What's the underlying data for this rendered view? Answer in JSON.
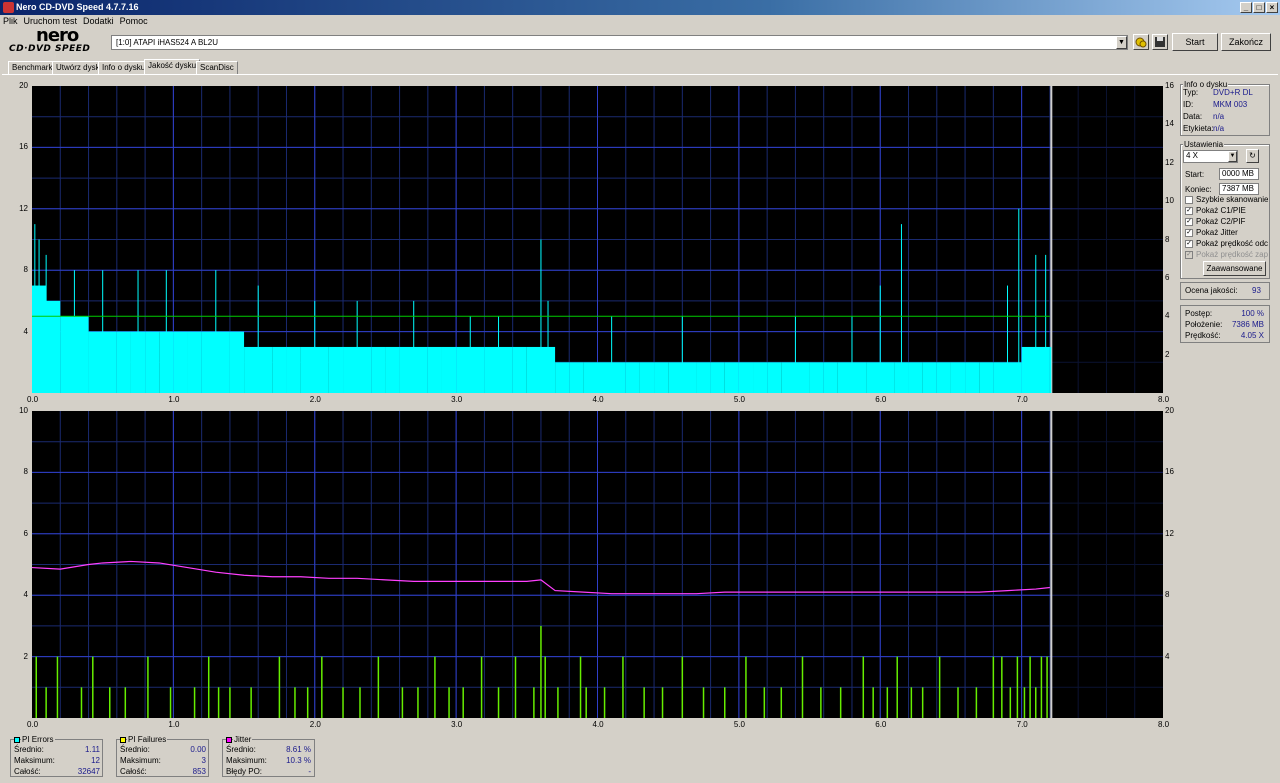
{
  "window": {
    "title": "Nero CD-DVD Speed 4.7.7.16",
    "minimize": "_",
    "maximize": "□",
    "close": "×"
  },
  "menu": [
    "Plik",
    "Uruchom test",
    "Dodatki",
    "Pomoc"
  ],
  "logo": {
    "main": "nero",
    "sub": "CD·DVD SPEED"
  },
  "toolbar": {
    "drive": "[1:0]   ATAPI iHAS524   A BL2U",
    "start": "Start",
    "close": "Zakończ"
  },
  "tabs": [
    "Benchmark",
    "Utwórz dysk",
    "Info o dysku",
    "Jakość dysku",
    "ScanDisc"
  ],
  "active_tab": 3,
  "disc_info": {
    "title": "Info o dysku",
    "rows": [
      {
        "label": "Typ:",
        "value": "DVD+R DL"
      },
      {
        "label": "ID:",
        "value": "MKM 003"
      },
      {
        "label": "Data:",
        "value": "n/a"
      },
      {
        "label": "Etykieta:",
        "value": "n/a"
      }
    ]
  },
  "settings": {
    "title": "Ustawienia",
    "speed": "4 X",
    "start_label": "Start:",
    "start_value": "0000 MB",
    "end_label": "Koniec:",
    "end_value": "7387 MB",
    "checks": [
      {
        "label": "Szybkie skanowanie",
        "checked": false,
        "enabled": true
      },
      {
        "label": "Pokaż C1/PIE",
        "checked": true,
        "enabled": true
      },
      {
        "label": "Pokaż C2/PIF",
        "checked": true,
        "enabled": true
      },
      {
        "label": "Pokaż Jitter",
        "checked": true,
        "enabled": true
      },
      {
        "label": "Pokaż prędkość odczytu",
        "checked": true,
        "enabled": true
      },
      {
        "label": "Pokaż prędkość zapisu",
        "checked": true,
        "enabled": false
      }
    ],
    "advanced": "Zaawansowane"
  },
  "quality": {
    "label": "Ocena jakości:",
    "value": "93"
  },
  "progress": {
    "rows": [
      {
        "label": "Postęp:",
        "value": "100 %"
      },
      {
        "label": "Położenie:",
        "value": "7386 MB"
      },
      {
        "label": "Prędkość:",
        "value": "4.05 X"
      }
    ]
  },
  "stats": {
    "pi_errors": {
      "title": "PI Errors",
      "color": "#00ffff",
      "rows": [
        {
          "label": "Średnio:",
          "value": "1.11"
        },
        {
          "label": "Maksimum:",
          "value": "12"
        },
        {
          "label": "Całość:",
          "value": "32647"
        }
      ]
    },
    "pi_failures": {
      "title": "PI Failures",
      "color": "#ffff00",
      "rows": [
        {
          "label": "Średnio:",
          "value": "0.00"
        },
        {
          "label": "Maksimum:",
          "value": "3"
        },
        {
          "label": "Całość:",
          "value": "853"
        }
      ]
    },
    "jitter": {
      "title": "Jitter",
      "color": "#ff00ff",
      "rows": [
        {
          "label": "Średnio:",
          "value": "8.61 %"
        },
        {
          "label": "Maksimum:",
          "value": "10.3 %"
        }
      ]
    },
    "po_errors": {
      "label": "Błędy PO:",
      "value": "-"
    }
  },
  "chart_data": [
    {
      "type": "area",
      "x_ticks": [
        "0.0",
        "1.0",
        "2.0",
        "3.0",
        "4.0",
        "5.0",
        "6.0",
        "7.0",
        "8.0"
      ],
      "y_left_ticks": [
        "20",
        "16",
        "12",
        "8",
        "4"
      ],
      "y_right_ticks": [
        "16",
        "14",
        "12",
        "10",
        "8",
        "6",
        "4",
        "2"
      ],
      "xlim": [
        0,
        8
      ],
      "ylim_left": [
        0,
        20
      ],
      "ylim_right": [
        0,
        16
      ],
      "scan_end_x": 7.21,
      "grid": true,
      "series": [
        {
          "color": "#00ffff",
          "kind": "pie",
          "x": [
            0.0,
            0.1,
            0.2,
            0.3,
            0.4,
            0.5,
            0.6,
            0.7,
            0.8,
            0.9,
            1.0,
            1.1,
            1.2,
            1.3,
            1.4,
            1.5,
            1.6,
            1.7,
            1.8,
            1.9,
            2.0,
            2.1,
            2.2,
            2.3,
            2.4,
            2.5,
            2.6,
            2.7,
            2.8,
            2.9,
            3.0,
            3.1,
            3.2,
            3.3,
            3.4,
            3.5,
            3.6,
            3.7,
            3.8,
            3.9,
            4.0,
            4.1,
            4.2,
            4.3,
            4.4,
            4.5,
            4.6,
            4.7,
            4.8,
            4.9,
            5.0,
            5.1,
            5.2,
            5.3,
            5.4,
            5.5,
            5.6,
            5.7,
            5.8,
            5.9,
            6.0,
            6.1,
            6.2,
            6.3,
            6.4,
            6.5,
            6.6,
            6.7,
            6.8,
            6.9,
            7.0,
            7.1,
            7.2
          ],
          "values": [
            7,
            6,
            5,
            5,
            4,
            4,
            4,
            4,
            4,
            4,
            4,
            4,
            4,
            4,
            4,
            3,
            3,
            3,
            3,
            3,
            3,
            3,
            3,
            3,
            3,
            3,
            3,
            3,
            3,
            3,
            3,
            3,
            3,
            3,
            3,
            3,
            3,
            2,
            2,
            2,
            2,
            2,
            2,
            2,
            2,
            2,
            2,
            2,
            2,
            2,
            2,
            2,
            2,
            2,
            2,
            2,
            2,
            2,
            2,
            2,
            2,
            2,
            2,
            2,
            2,
            2,
            2,
            2,
            2,
            2,
            3,
            3,
            3
          ],
          "peaks": [
            [
              0.02,
              11
            ],
            [
              0.05,
              10
            ],
            [
              0.1,
              9
            ],
            [
              0.3,
              8
            ],
            [
              0.5,
              8
            ],
            [
              0.75,
              8
            ],
            [
              0.95,
              8
            ],
            [
              1.3,
              8
            ],
            [
              1.6,
              7
            ],
            [
              2.0,
              6
            ],
            [
              2.3,
              6
            ],
            [
              2.7,
              6
            ],
            [
              3.1,
              5
            ],
            [
              3.3,
              5
            ],
            [
              3.6,
              10
            ],
            [
              3.65,
              6
            ],
            [
              4.1,
              5
            ],
            [
              4.6,
              5
            ],
            [
              5.4,
              5
            ],
            [
              5.8,
              5
            ],
            [
              6.0,
              7
            ],
            [
              6.15,
              11
            ],
            [
              6.9,
              7
            ],
            [
              6.98,
              12
            ],
            [
              7.1,
              9
            ],
            [
              7.17,
              9
            ]
          ]
        },
        {
          "color": "#00cc00",
          "kind": "speed",
          "x": [
            0.0,
            7.2
          ],
          "values": [
            4.0,
            4.0
          ]
        }
      ]
    },
    {
      "type": "bar",
      "x_ticks": [
        "0.0",
        "1.0",
        "2.0",
        "3.0",
        "4.0",
        "5.0",
        "6.0",
        "7.0",
        "8.0"
      ],
      "y_left_ticks": [
        "10",
        "8",
        "6",
        "4",
        "2"
      ],
      "y_right_ticks": [
        "20",
        "16",
        "12",
        "8",
        "4"
      ],
      "xlim": [
        0,
        8
      ],
      "ylim_left": [
        0,
        10
      ],
      "ylim_right": [
        0,
        20
      ],
      "scan_end_x": 7.21,
      "grid": true,
      "series": [
        {
          "color": "#66ee00",
          "kind": "pif",
          "x": [
            0.03,
            0.1,
            0.18,
            0.35,
            0.43,
            0.55,
            0.66,
            0.82,
            0.98,
            1.15,
            1.25,
            1.32,
            1.4,
            1.55,
            1.75,
            1.86,
            1.95,
            2.05,
            2.2,
            2.32,
            2.45,
            2.62,
            2.73,
            2.85,
            2.95,
            3.05,
            3.18,
            3.3,
            3.42,
            3.55,
            3.6,
            3.63,
            3.72,
            3.88,
            3.92,
            4.05,
            4.18,
            4.33,
            4.46,
            4.6,
            4.75,
            4.9,
            5.05,
            5.18,
            5.3,
            5.45,
            5.58,
            5.72,
            5.88,
            5.95,
            6.05,
            6.12,
            6.22,
            6.3,
            6.42,
            6.55,
            6.68,
            6.8,
            6.86,
            6.92,
            6.97,
            7.02,
            7.06,
            7.1,
            7.14,
            7.18
          ],
          "values": [
            2,
            1,
            2,
            1,
            2,
            1,
            1,
            2,
            1,
            1,
            2,
            1,
            1,
            1,
            2,
            1,
            1,
            2,
            1,
            1,
            2,
            1,
            1,
            2,
            1,
            1,
            2,
            1,
            2,
            1,
            3,
            2,
            1,
            2,
            1,
            1,
            2,
            1,
            1,
            2,
            1,
            1,
            2,
            1,
            1,
            2,
            1,
            1,
            2,
            1,
            1,
            2,
            1,
            1,
            2,
            1,
            1,
            2,
            2,
            1,
            2,
            1,
            2,
            1,
            2,
            2
          ]
        },
        {
          "color": "#ff40ff",
          "kind": "jitter",
          "x": [
            0.0,
            0.2,
            0.4,
            0.5,
            0.7,
            0.9,
            1.1,
            1.3,
            1.5,
            1.7,
            1.9,
            2.1,
            2.3,
            2.5,
            2.7,
            2.9,
            3.1,
            3.3,
            3.5,
            3.6,
            3.7,
            3.9,
            4.1,
            4.3,
            4.5,
            4.7,
            4.9,
            5.1,
            5.3,
            5.5,
            5.7,
            5.9,
            6.1,
            6.3,
            6.5,
            6.7,
            6.9,
            7.1,
            7.2
          ],
          "values": [
            9.8,
            9.7,
            10.0,
            10.1,
            10.2,
            10.1,
            9.8,
            9.5,
            9.3,
            9.2,
            9.2,
            9.1,
            9.1,
            9.0,
            8.9,
            8.9,
            8.9,
            8.9,
            8.9,
            9.0,
            8.3,
            8.2,
            8.1,
            8.1,
            8.1,
            8.1,
            8.2,
            8.2,
            8.2,
            8.2,
            8.2,
            8.2,
            8.2,
            8.2,
            8.2,
            8.2,
            8.3,
            8.4,
            8.5
          ]
        }
      ]
    }
  ]
}
